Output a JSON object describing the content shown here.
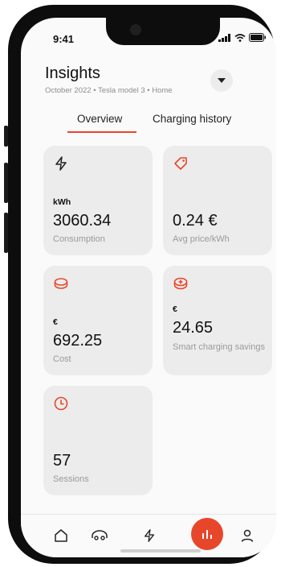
{
  "status_bar": {
    "time": "9:41"
  },
  "header": {
    "title": "Insights",
    "subtitle": "October 2022 • Tesla model 3 • Home"
  },
  "tabs": [
    {
      "label": "Overview",
      "active": true
    },
    {
      "label": "Charging history",
      "active": false
    }
  ],
  "cards": {
    "consumption": {
      "icon": "lightning-icon",
      "unit": "kWh",
      "value": "3060.34",
      "label": "Consumption"
    },
    "avg_price": {
      "icon": "price-tag-icon",
      "unit": "",
      "value": "0.24 €",
      "label": "Avg price/kWh"
    },
    "cost": {
      "icon": "coins-icon",
      "unit": "€",
      "value": "692.25",
      "label": "Cost"
    },
    "savings": {
      "icon": "coin-plus-icon",
      "unit": "€",
      "value": "24.65",
      "label": "Smart charging savings"
    },
    "sessions": {
      "icon": "clock-icon",
      "unit": "",
      "value": "57",
      "label": "Sessions"
    }
  },
  "nav": {
    "items": [
      "home-icon",
      "car-icon",
      "lightning-icon",
      "bar-chart-icon",
      "profile-icon"
    ],
    "active": "bar-chart-icon"
  },
  "colors": {
    "accent": "#e8462b",
    "card_bg": "#ececec",
    "muted_text": "#9a9a9a"
  }
}
